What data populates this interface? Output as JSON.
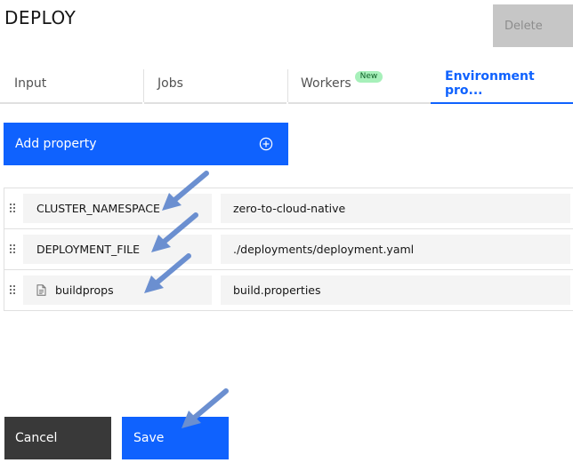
{
  "header": {
    "title": "DEPLOY",
    "delete_label": "Delete"
  },
  "tabs": [
    {
      "label": "Input",
      "active": false
    },
    {
      "label": "Jobs",
      "active": false
    },
    {
      "label": "Workers",
      "active": false,
      "badge": "New"
    },
    {
      "label": "Environment pro...",
      "active": true
    }
  ],
  "add_property": {
    "label": "Add property",
    "icon": "add-circle-icon"
  },
  "properties": [
    {
      "key": "CLUSTER_NAMESPACE",
      "value": "zero-to-cloud-native",
      "icon": null
    },
    {
      "key": "DEPLOYMENT_FILE",
      "value": "./deployments/deployment.yaml",
      "icon": null
    },
    {
      "key": "buildprops",
      "value": "build.properties",
      "icon": "document-icon"
    }
  ],
  "footer": {
    "cancel_label": "Cancel",
    "save_label": "Save"
  },
  "colors": {
    "primary": "#0f62fe",
    "annotation_arrow": "#6b8fd0",
    "cancel_bg": "#393939",
    "disabled_bg": "#c6c6c6",
    "badge_bg": "#a7f0ba"
  }
}
